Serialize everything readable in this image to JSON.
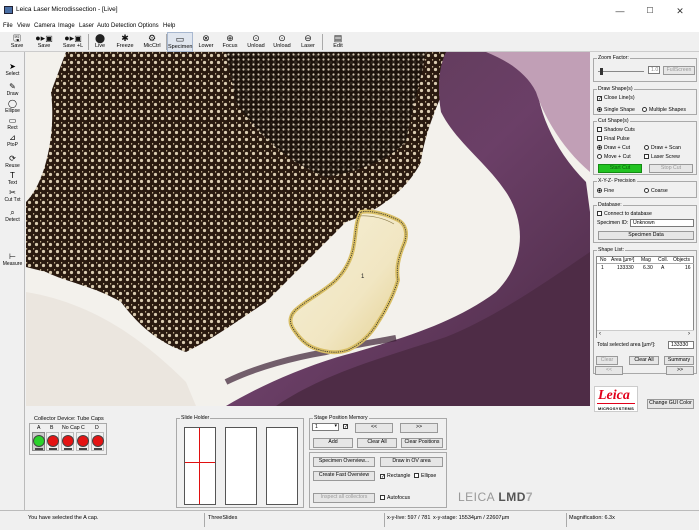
{
  "window": {
    "title": "Leica Laser Microdissection - [Live]",
    "min": "—",
    "max": "☐",
    "close": "✕"
  },
  "menu": [
    "File",
    "View",
    "Camera",
    "Image",
    "Laser",
    "Auto Detection",
    "Options",
    "Help"
  ],
  "toolbar": [
    {
      "label": "Save",
      "icon": "save-icon"
    },
    {
      "label": "Save",
      "icon": "record-save-icon"
    },
    {
      "label": "Save +L",
      "icon": "record-save-plus-icon"
    },
    {
      "label": "Live",
      "icon": "live-icon"
    },
    {
      "label": "Freeze",
      "icon": "freeze-icon"
    },
    {
      "label": "MicCtrl",
      "icon": "gear-icon"
    },
    {
      "label": "Specimen",
      "icon": "specimen-icon"
    },
    {
      "label": "Lower",
      "icon": "lower-icon"
    },
    {
      "label": "Focus",
      "icon": "focus-icon"
    },
    {
      "label": "Unload",
      "icon": "unload-icon"
    },
    {
      "label": "Unload",
      "icon": "unload-icon"
    },
    {
      "label": "Laser",
      "icon": "laser-icon"
    },
    {
      "label": "Edit",
      "icon": "edit-icon"
    }
  ],
  "left_tools": [
    {
      "label": "Select",
      "glyph": "➤"
    },
    {
      "label": "Draw",
      "glyph": "✎"
    },
    {
      "label": "Ellipse",
      "glyph": "◯"
    },
    {
      "label": "Rect",
      "glyph": "▭"
    },
    {
      "label": "PtoP",
      "glyph": "⊿"
    },
    {
      "label": "Reuse",
      "glyph": "⟳"
    },
    {
      "label": "Text",
      "glyph": "T"
    },
    {
      "label": "Cut Txt",
      "glyph": "✂"
    },
    {
      "label": "Detect",
      "glyph": "⌕"
    },
    {
      "label": "Measure",
      "glyph": "⊢"
    }
  ],
  "image": {
    "shape_label": "1"
  },
  "right": {
    "zoom": {
      "label": "Zoom Factor:",
      "value": "1.0",
      "fullscreen": "FullScreen"
    },
    "draw_shapes": {
      "label": "Draw Shape(s)",
      "close_lines": "Close Line(s)",
      "single": "Single Shape",
      "multiple": "Multiple Shapes"
    },
    "cut_shapes": {
      "label": "Cut Shape(s)",
      "shadow_cuts": "Shadow Cuts",
      "final_pulse": "Final Pulse",
      "draw_cut": "Draw + Cut",
      "draw_scan": "Draw + Scan",
      "move_cut": "Move + Cut",
      "laser_screw": "Laser Screw",
      "start_cut": "Start Cut",
      "stop_cut": "Stop Cut"
    },
    "precision": {
      "label": "X-Y-Z- Precision",
      "fine": "Fine",
      "coarse": "Coarse"
    },
    "database": {
      "label": "Database:",
      "connect": "Connect to database",
      "specimen_id_label": "Specimen ID:",
      "specimen_id": "Unknown",
      "specimen_data": "Specimen Data"
    },
    "shape_list": {
      "label": "Shape List:",
      "columns": [
        "No",
        "Area [µm²]",
        "Mag",
        "Coll.",
        "Objects"
      ],
      "rows": [
        [
          "1",
          "133330",
          "6.30",
          "A",
          "16"
        ]
      ],
      "total_label": "Total selected area [µm²]:",
      "total_value": "133330"
    },
    "buttons": {
      "clear": "Clear",
      "clear_all": "Clear All",
      "summary": "Summary",
      "prev": "<<",
      "next": ">>"
    },
    "brand": {
      "logo": "Leica",
      "sub": "MICROSYSTEMS",
      "change_color": "Change GUI Color"
    }
  },
  "bottom": {
    "collector": {
      "label": "Collector Device: Tube Caps",
      "caps": [
        "A",
        "B",
        "No Cap",
        "C",
        "D"
      ],
      "selected_index": 0
    },
    "slide_holder": {
      "label": "Slide Holder"
    },
    "stage_memory": {
      "label": "Stage Position Memory",
      "select_value": "1",
      "prev": "<<",
      "next": ">>",
      "add": "Add",
      "clear_all": "Clear All",
      "clear_positions": "Clear Positions"
    },
    "overview": {
      "specimen_overview": "Specimen Overview...",
      "draw_ov": "Draw in OV area",
      "create_fast": "Create Fast Overview",
      "rectangle": "Rectangle",
      "ellipse": "Ellipse",
      "inspect": "Inspect all collectors",
      "autofocus": "Autofocus"
    },
    "product": {
      "brand": "LEICA",
      "model": "LMD",
      "version": "7"
    }
  },
  "status": {
    "message": "You have selected the A cap.",
    "slides": "ThreeSlides",
    "xy_live": "x-y-live: 597 / 781",
    "xy_stage": "x-y-stage: 15534µm / 22607µm",
    "magnification": "Magnification: 6.3x"
  }
}
